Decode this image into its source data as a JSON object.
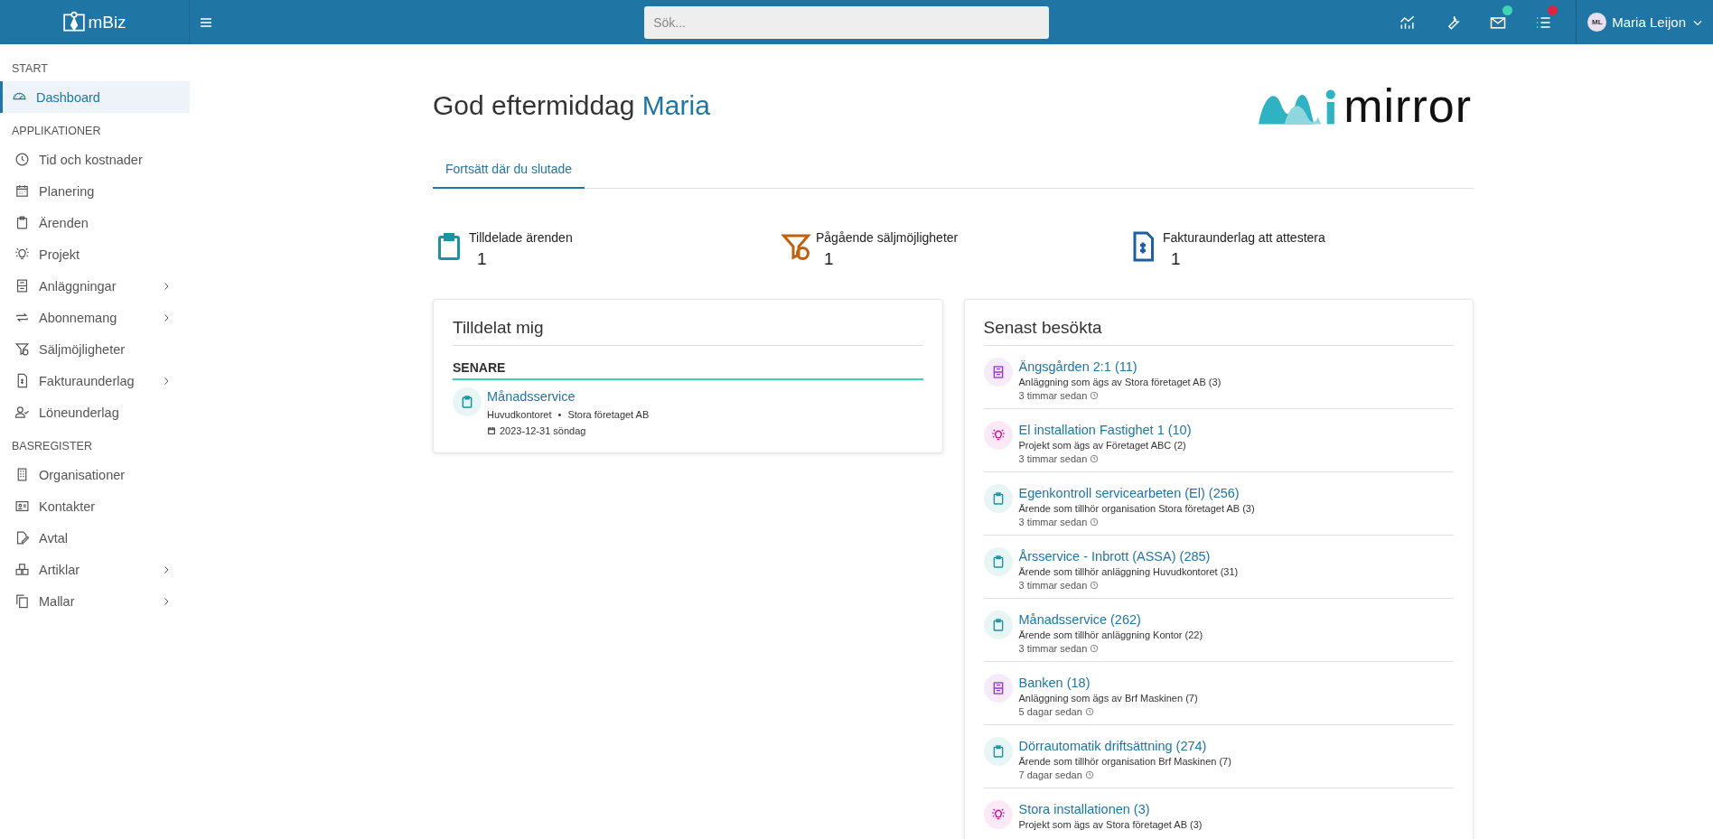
{
  "topbar": {
    "brand": "mBiz",
    "search": {
      "placeholder": "Sök..."
    },
    "icons": [
      {
        "kind": "chart"
      },
      {
        "kind": "wrench"
      },
      {
        "kind": "mail",
        "color": "#3dd6b5"
      },
      {
        "kind": "list",
        "color": "#e0243f"
      }
    ],
    "user": {
      "initials": "ML",
      "name": "Maria Leijon"
    }
  },
  "sidebar": {
    "sections": [
      {
        "title": "START",
        "items": [
          {
            "label": "Dashboard",
            "kind": "gauge",
            "selected": true,
            "expandable": false
          }
        ]
      },
      {
        "title": "APPLIKATIONER",
        "items": [
          {
            "label": "Tid och kostnader",
            "kind": "clock",
            "selected": false,
            "expandable": false
          },
          {
            "label": "Planering",
            "kind": "calendar",
            "selected": false,
            "expandable": false
          },
          {
            "label": "Ärenden",
            "kind": "clipboard",
            "selected": false,
            "expandable": false
          },
          {
            "label": "Projekt",
            "kind": "bulb",
            "selected": false,
            "expandable": false
          },
          {
            "label": "Anläggningar",
            "kind": "cabinet",
            "selected": false,
            "expandable": true
          },
          {
            "label": "Abonnemang",
            "kind": "repeat",
            "selected": false,
            "expandable": true
          },
          {
            "label": "Säljmöjligheter",
            "kind": "funnel",
            "selected": false,
            "expandable": false
          },
          {
            "label": "Fakturaunderlag",
            "kind": "invoice",
            "selected": false,
            "expandable": true
          },
          {
            "label": "Löneunderlag",
            "kind": "person",
            "selected": false,
            "expandable": false
          }
        ]
      },
      {
        "title": "BASREGISTER",
        "items": [
          {
            "label": "Organisationer",
            "kind": "building",
            "selected": false,
            "expandable": false
          },
          {
            "label": "Kontakter",
            "kind": "card",
            "selected": false,
            "expandable": false
          },
          {
            "label": "Avtal",
            "kind": "sign",
            "selected": false,
            "expandable": false
          },
          {
            "label": "Artiklar",
            "kind": "boxes",
            "selected": false,
            "expandable": true
          },
          {
            "label": "Mallar",
            "kind": "copy",
            "selected": false,
            "expandable": true
          }
        ]
      }
    ]
  },
  "greeting": {
    "text": "God eftermiddag",
    "name": "Maria"
  },
  "logo": {
    "text": "mirror"
  },
  "tabs": [
    {
      "label": "Fortsätt där du slutade",
      "selected": true
    }
  ],
  "stats": [
    {
      "kind": "clipboard",
      "label": "Tilldelade ärenden",
      "value": "1"
    },
    {
      "kind": "funnel",
      "label": "Pågående säljmöjligheter",
      "value": "1"
    },
    {
      "kind": "invoice",
      "label": "Fakturaunderlag att attestera",
      "value": "1"
    }
  ],
  "assigned": {
    "title": "Tilldelat mig",
    "group": "SENARE",
    "items": [
      {
        "kind": "case",
        "title": "Månadsservice",
        "place": "Huvudkontoret",
        "separator": "•",
        "org": "Stora företaget AB",
        "date": "2023-12-31 söndag"
      }
    ]
  },
  "recent": {
    "title": "Senast besökta",
    "items": [
      {
        "kind": "facility",
        "title": "Ängsgården 2:1 (11)",
        "subtitle": "Anläggning som ägs av Stora företaget AB (3)",
        "time": "3 timmar sedan"
      },
      {
        "kind": "project",
        "title": "El installation Fastighet 1 (10)",
        "subtitle": "Projekt som ägs av Företaget ABC (2)",
        "time": "3 timmar sedan"
      },
      {
        "kind": "case",
        "title": "Egenkontroll servicearbeten (El) (256)",
        "subtitle": "Ärende som tillhör organisation Stora företaget AB (3)",
        "time": "3 timmar sedan"
      },
      {
        "kind": "case",
        "title": "Årsservice - Inbrott (ASSA) (285)",
        "subtitle": "Ärende som tillhör anläggning Huvudkontoret (31)",
        "time": "3 timmar sedan"
      },
      {
        "kind": "case",
        "title": "Månadsservice (262)",
        "subtitle": "Ärende som tillhör anläggning Kontor (22)",
        "time": "3 timmar sedan"
      },
      {
        "kind": "facility",
        "title": "Banken (18)",
        "subtitle": "Anläggning som ägs av Brf Maskinen (7)",
        "time": "5 dagar sedan"
      },
      {
        "kind": "case",
        "title": "Dörrautomatik driftsättning (274)",
        "subtitle": "Ärende som tillhör organisation Brf Maskinen (7)",
        "time": "7 dagar sedan"
      },
      {
        "kind": "project",
        "title": "Stora installationen (3)",
        "subtitle": "Projekt som ägs av Stora företaget AB (3)"
      }
    ]
  }
}
